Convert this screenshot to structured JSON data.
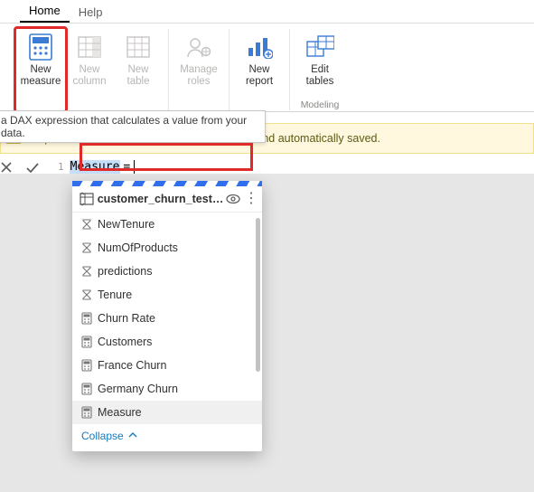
{
  "tabs": {
    "home": "Home",
    "help": "Help"
  },
  "ribbon": {
    "new_measure": {
      "l1": "New",
      "l2": "measure"
    },
    "new_column": {
      "l1": "New",
      "l2": "column"
    },
    "new_table": {
      "l1": "New",
      "l2": "table"
    },
    "manage_roles": {
      "l1": "Manage",
      "l2": "roles"
    },
    "new_report": {
      "l1": "New",
      "l2": "report"
    },
    "edit_tables": {
      "l1": "Edit",
      "l2": "tables"
    },
    "group_modeling": "Modeling"
  },
  "tooltip": "a DAX expression that calculates a value from your data.",
  "warning": "Keep in mind your changes will be permanent and automatically saved.",
  "formula": {
    "lineno": "1",
    "selected": "Measure",
    "eq": "="
  },
  "popup": {
    "title": "customer_churn_test_...",
    "items": [
      {
        "icon": "sigma",
        "label": "NewTenure"
      },
      {
        "icon": "sigma",
        "label": "NumOfProducts"
      },
      {
        "icon": "sigma",
        "label": "predictions"
      },
      {
        "icon": "sigma",
        "label": "Tenure"
      },
      {
        "icon": "calc",
        "label": "Churn Rate"
      },
      {
        "icon": "calc",
        "label": "Customers"
      },
      {
        "icon": "calc",
        "label": "France Churn"
      },
      {
        "icon": "calc",
        "label": "Germany Churn"
      },
      {
        "icon": "calc",
        "label": "Measure",
        "sel": true
      }
    ],
    "collapse": "Collapse"
  }
}
